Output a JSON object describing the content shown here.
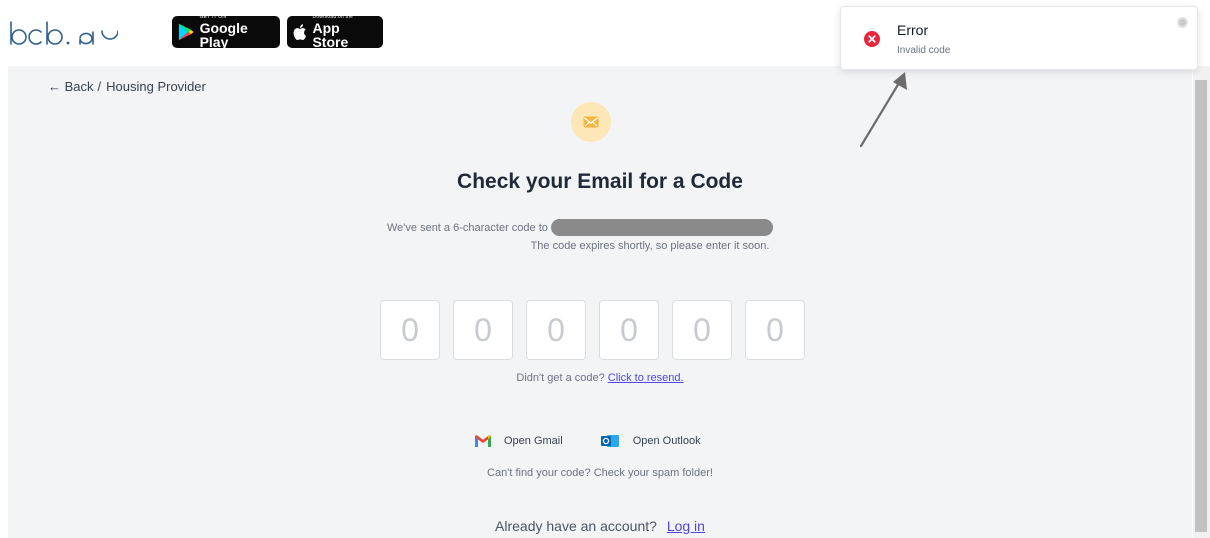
{
  "brand": {
    "logo_text": "bcb.ai"
  },
  "badges": {
    "google_play": {
      "small": "GET IT ON",
      "big": "Google Play"
    },
    "app_store": {
      "small": "Download on the",
      "big": "App Store"
    }
  },
  "breadcrumb": {
    "back": "← Back",
    "separator": "/",
    "current": "Housing Provider"
  },
  "verify": {
    "title": "Check your Email for a Code",
    "desc_prefix": "We've sent a 6-character code to",
    "desc_line2": "The code expires shortly, so please enter it soon.",
    "code_placeholders": [
      "0",
      "0",
      "0",
      "0",
      "0",
      "0"
    ],
    "resend_prefix": "Didn't get a code?",
    "resend_link": "Click to resend.",
    "open_gmail": "Open Gmail",
    "open_outlook": "Open Outlook",
    "spam_hint": "Can't find your code? Check your spam folder!",
    "account_prompt": "Already have an account?",
    "login_link": "Log in"
  },
  "toast": {
    "title": "Error",
    "message": "Invalid code",
    "icon": "error-x-icon"
  },
  "colors": {
    "accent": "#4f46e5",
    "mail_badge": "#fde7b7",
    "mail_icon": "#f4b63f",
    "error": "#e5263c"
  }
}
